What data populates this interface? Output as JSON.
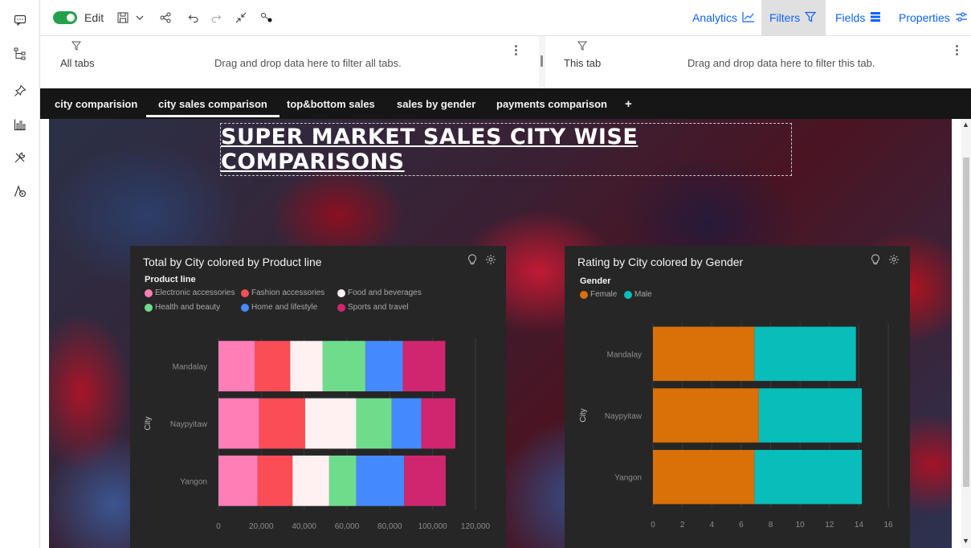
{
  "toolbar": {
    "edit_label": "Edit",
    "right_links": [
      {
        "label": "Analytics",
        "icon": "analytics-icon"
      },
      {
        "label": "Filters",
        "icon": "filter-icon"
      },
      {
        "label": "Fields",
        "icon": "fields-icon"
      },
      {
        "label": "Properties",
        "icon": "properties-icon"
      }
    ]
  },
  "filterbar": {
    "all_tabs_label": "All tabs",
    "all_tabs_hint": "Drag and drop data here to filter all tabs.",
    "this_tab_label": "This tab",
    "this_tab_hint": "Drag and drop data here to filter this tab."
  },
  "tabs": [
    {
      "label": "city comparision"
    },
    {
      "label": "city sales comparison"
    },
    {
      "label": "top&bottom sales"
    },
    {
      "label": "sales by gender"
    },
    {
      "label": "payments comparison"
    },
    {
      "label": "+"
    }
  ],
  "dashboard_title": "SUPER MARKET SALES CITY WISE COMPARISONS",
  "colors": {
    "accent": "#0f62fe",
    "toggle_on": "#24a148",
    "panel_bg": "#262626"
  },
  "chart_data": [
    {
      "type": "bar",
      "orientation": "horizontal",
      "stacked": true,
      "title": "Total by City colored by Product line",
      "legend_title": "Product line",
      "ylabel": "City",
      "xlabel": "",
      "categories": [
        "Mandalay",
        "Naypyitaw",
        "Yangon"
      ],
      "xlim": [
        0,
        120000
      ],
      "xticks": [
        "0",
        "20,000",
        "40,000",
        "60,000",
        "80,000",
        "100,000",
        "120,000"
      ],
      "series": [
        {
          "name": "Electronic accessories",
          "color": "#ff7eb6",
          "values": [
            17000,
            19000,
            18300
          ]
        },
        {
          "name": "Fashion accessories",
          "color": "#fa4d56",
          "values": [
            16500,
            21500,
            16300
          ]
        },
        {
          "name": "Food and beverages",
          "color": "#fff1f1",
          "values": [
            15200,
            23800,
            17100
          ]
        },
        {
          "name": "Health and beauty",
          "color": "#6fdc8c",
          "values": [
            19900,
            16600,
            12600
          ]
        },
        {
          "name": "Home and lifestyle",
          "color": "#4589ff",
          "values": [
            17500,
            13800,
            22400
          ]
        },
        {
          "name": "Sports and travel",
          "color": "#d02670",
          "values": [
            19800,
            15900,
            19400
          ]
        }
      ]
    },
    {
      "type": "bar",
      "orientation": "horizontal",
      "stacked": true,
      "title": "Rating by City colored by Gender",
      "legend_title": "Gender",
      "ylabel": "City",
      "xlabel": "",
      "categories": [
        "Mandalay",
        "Naypyitaw",
        "Yangon"
      ],
      "xlim": [
        0,
        16
      ],
      "xticks": [
        "0",
        "2",
        "4",
        "6",
        "8",
        "10",
        "12",
        "14",
        "16"
      ],
      "series": [
        {
          "name": "Female",
          "color": "#d97008",
          "values": [
            6.9,
            7.2,
            6.9
          ]
        },
        {
          "name": "Male",
          "color": "#08bdba",
          "values": [
            6.9,
            7.0,
            7.3
          ]
        }
      ]
    }
  ]
}
